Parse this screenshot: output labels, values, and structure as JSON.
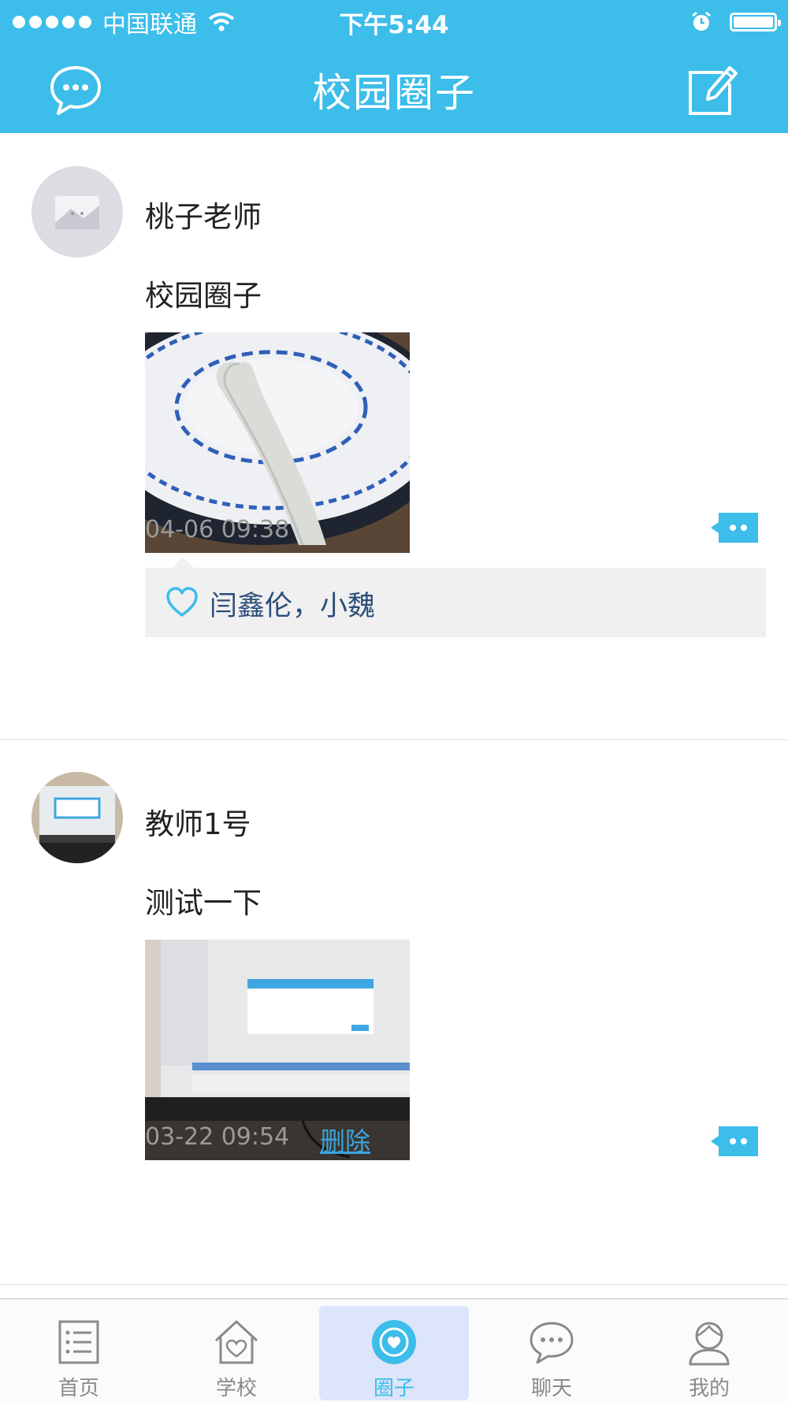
{
  "status_bar": {
    "carrier": "中国联通",
    "time": "下午5:44"
  },
  "nav": {
    "title": "校园圈子",
    "left_icon": "chat-bubble-icon",
    "right_icon": "compose-icon"
  },
  "posts": [
    {
      "author": "桃子老师",
      "text": "校园圈子",
      "time": "04-06 09:38",
      "likes": "闫鑫伦，小魏",
      "avatar": "default-avatar",
      "photo": "bowl-spoon-photo"
    },
    {
      "author": "教师1号",
      "text": "测试一下",
      "time": "03-22 09:54",
      "delete_label": "删除",
      "avatar": "monitor-avatar",
      "photo": "monitor-photo"
    }
  ],
  "tabs": [
    {
      "label": "首页",
      "icon": "list-icon"
    },
    {
      "label": "学校",
      "icon": "house-heart-icon"
    },
    {
      "label": "圈子",
      "icon": "circle-heart-icon",
      "active": true
    },
    {
      "label": "聊天",
      "icon": "chat-icon"
    },
    {
      "label": "我的",
      "icon": "person-icon"
    }
  ],
  "colors": {
    "accent": "#3cbdea",
    "active_tab_bg": "#dce5f9",
    "likes_bg": "#f0f0f0",
    "link": "#3aa5dc"
  }
}
